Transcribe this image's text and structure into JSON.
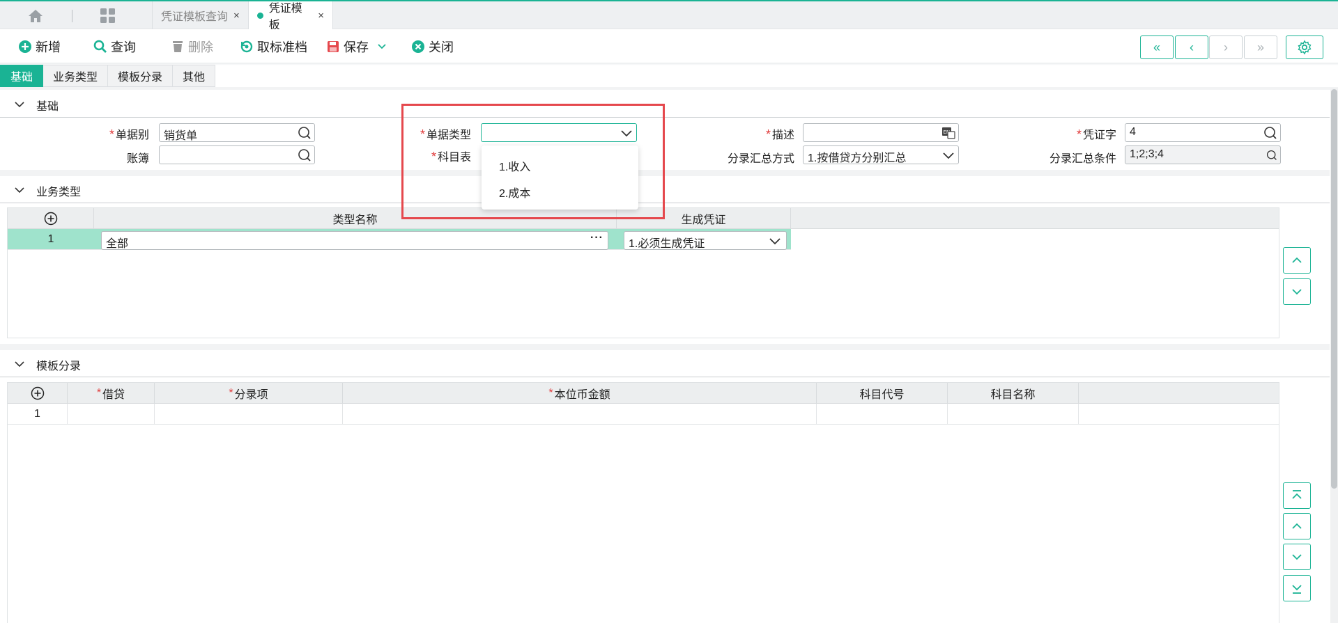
{
  "tabs": {
    "home_icon": "home-icon",
    "apps_icon": "grid-icon",
    "items": [
      {
        "label": "凭证模板查询",
        "close": "×",
        "active": false
      },
      {
        "label": "凭证模板",
        "close": "×",
        "active": true
      }
    ]
  },
  "toolbar": {
    "add": "新增",
    "query": "查询",
    "delete": "删除",
    "unmark": "取标准档",
    "save": "保存",
    "close": "关闭",
    "nav_first": "«",
    "nav_prev": "‹",
    "nav_next": "›",
    "nav_last": "»"
  },
  "subtabs": [
    "基础",
    "业务类型",
    "模板分录",
    "其他"
  ],
  "basic": {
    "title": "基础",
    "fields": {
      "doc_kind": {
        "label": "单据别",
        "value": "销货单"
      },
      "ledger": {
        "label": "账簿",
        "value": ""
      },
      "doc_type": {
        "label": "单据类型",
        "value": ""
      },
      "subject_table": {
        "label": "科目表",
        "value": ""
      },
      "description": {
        "label": "描述",
        "value": ""
      },
      "voucher_word": {
        "label": "凭证字",
        "value": "4"
      },
      "summary_method": {
        "label": "分录汇总方式",
        "value": "1.按借贷方分别汇总"
      },
      "summary_condition": {
        "label": "分录汇总条件",
        "value": "1;2;3;4"
      }
    },
    "doc_type_options": [
      "1.收入",
      "2.成本"
    ]
  },
  "business": {
    "title": "业务类型",
    "columns": [
      "类型名称",
      "生成凭证"
    ],
    "rows": [
      {
        "index": "1",
        "name": "全部",
        "generate": "1.必须生成凭证",
        "more": "···"
      }
    ]
  },
  "entries": {
    "title": "模板分录",
    "columns": [
      "借贷",
      "分录项",
      "本位币金额",
      "科目代号",
      "科目名称"
    ],
    "required": [
      true,
      true,
      true,
      false,
      false
    ],
    "rows": [
      {
        "index": "1"
      }
    ]
  },
  "colors": {
    "accent": "#1ab394",
    "required": "#e03b3b",
    "highlight": "#e5484d"
  }
}
